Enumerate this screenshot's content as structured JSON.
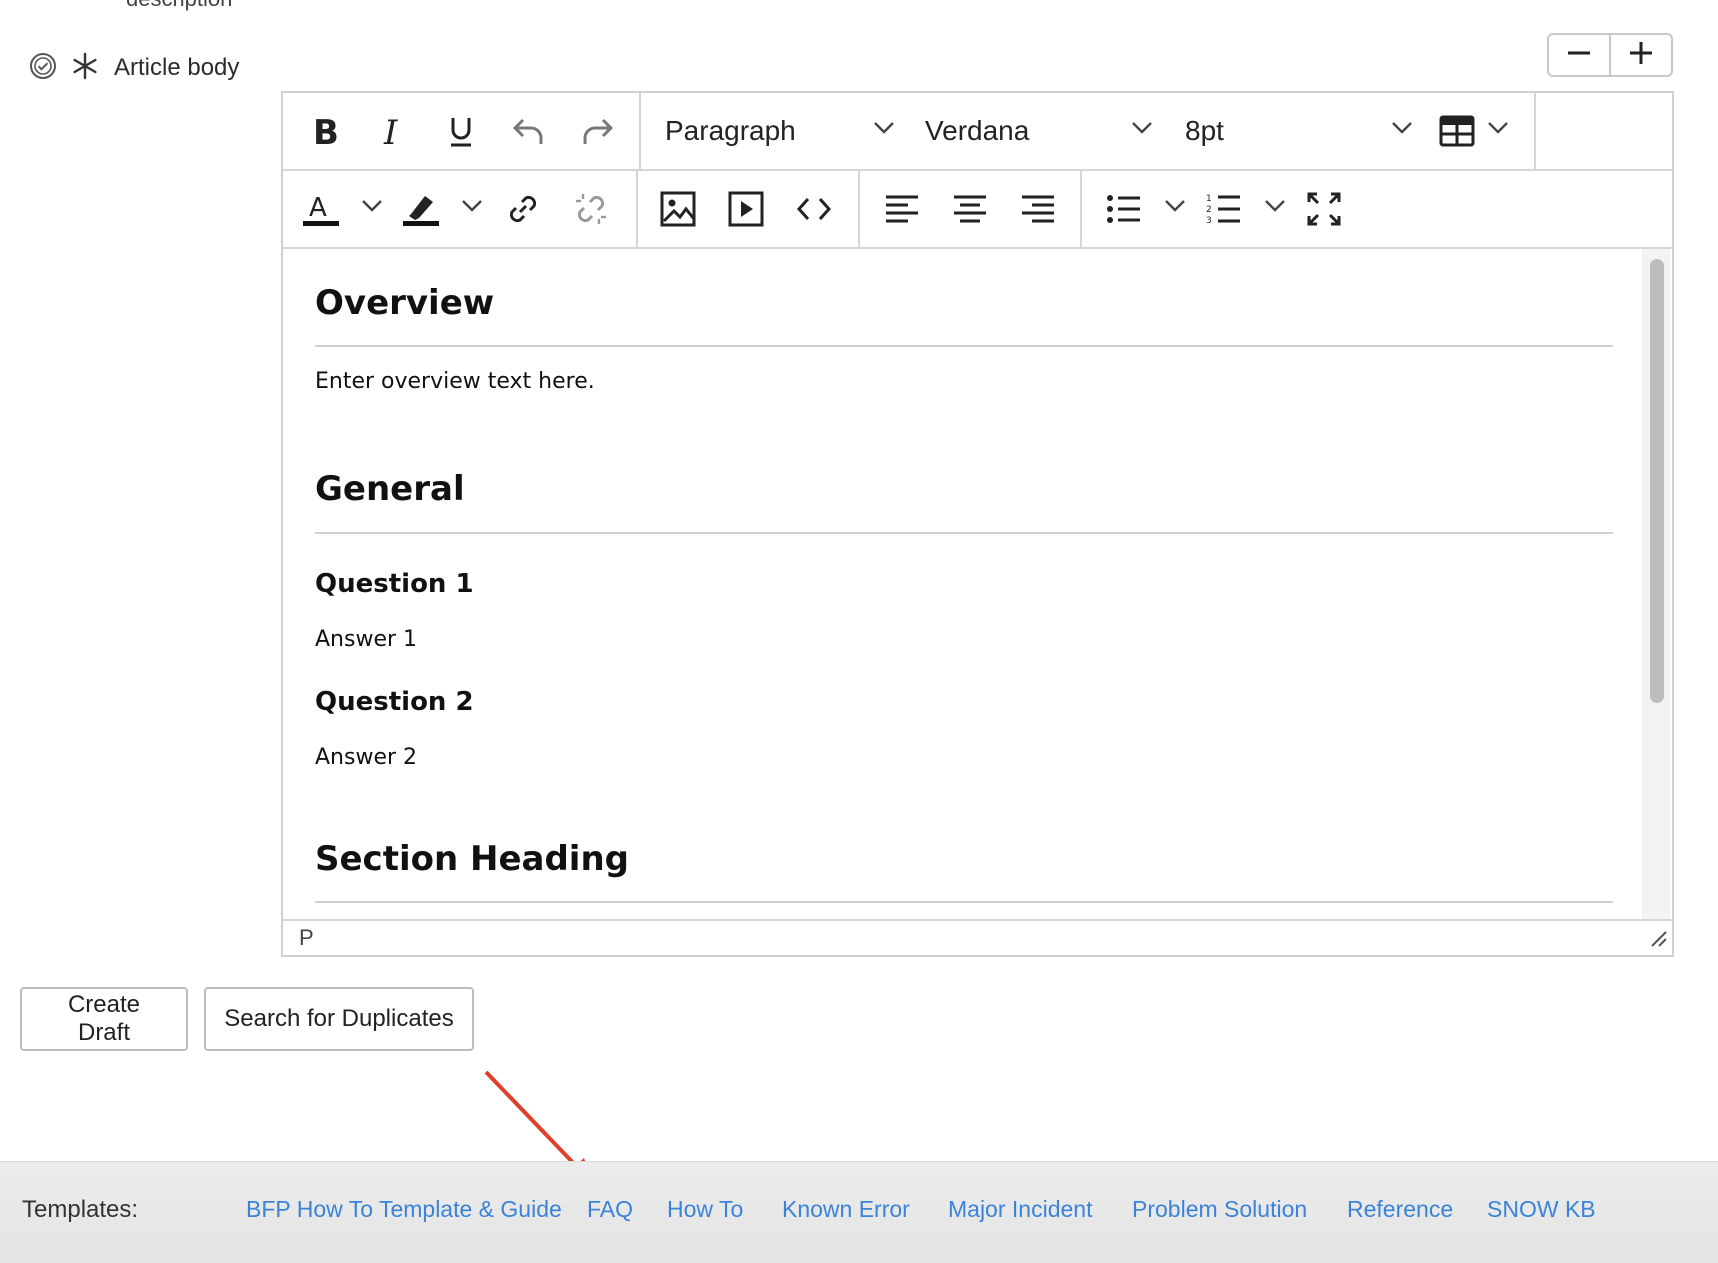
{
  "top_cut_text": "description",
  "field": {
    "label": "Article body",
    "required_glyph": "*"
  },
  "zoom": {
    "minus_icon": "minus-icon",
    "plus_icon": "plus-icon"
  },
  "toolbar": {
    "block_format": "Paragraph",
    "font_family": "Verdana",
    "font_size": "8pt"
  },
  "content": {
    "overview_heading": "Overview",
    "overview_text": "Enter overview text here.",
    "general_heading": "General",
    "q1": "Question 1",
    "a1": "Answer 1",
    "q2": "Question 2",
    "a2": "Answer 2",
    "section_heading": "Section Heading"
  },
  "status_path": "P",
  "buttons": {
    "create_draft": "Create Draft",
    "search_duplicates": "Search for Duplicates"
  },
  "templates": {
    "label": "Templates:",
    "items": [
      "BFP How To Template & Guide",
      "FAQ",
      "How To",
      "Known Error",
      "Major Incident",
      "Problem Solution",
      "Reference",
      "SNOW KB"
    ]
  },
  "colors": {
    "link": "#3a83d8",
    "annotation_arrow": "#e0402a"
  }
}
